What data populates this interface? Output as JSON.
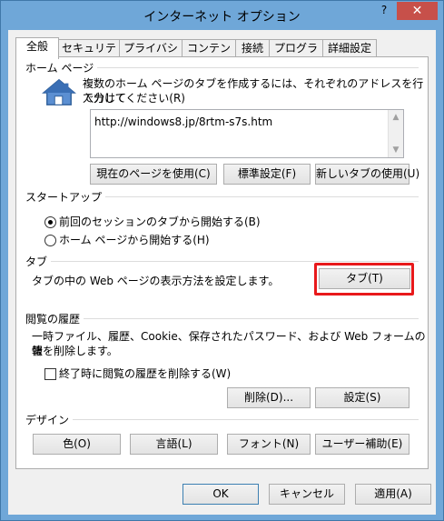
{
  "window": {
    "title": "インターネット オプション",
    "help": "?",
    "close": "✕"
  },
  "tabs": [
    "全般",
    "セキュリティ",
    "プライバシー",
    "コンテンツ",
    "接続",
    "プログラム",
    "詳細設定"
  ],
  "home": {
    "group": "ホーム ページ",
    "description_1": "複数のホーム ページのタブを作成するには、それぞれのアドレスを行で分けて",
    "description_2": "入力してください(R)",
    "url": "http://windows8.jp/8rtm-s7s.htm",
    "btn_current": "現在のページを使用(C)",
    "btn_default": "標準設定(F)",
    "btn_newtab": "新しいタブの使用(U)"
  },
  "startup": {
    "group": "スタートアップ",
    "opt_session": "前回のセッションのタブから開始する(B)",
    "opt_home": "ホーム ページから開始する(H)"
  },
  "tabs_group": {
    "group": "タブ",
    "description": "タブの中の Web ページの表示方法を設定します。",
    "btn_tabs": "タブ(T)"
  },
  "history": {
    "group": "閲覧の履歴",
    "description_1": "一時ファイル、履歴、Cookie、保存されたパスワード、および Web フォームの情",
    "description_2": "報を削除します。",
    "checkbox_label": "終了時に閲覧の履歴を削除する(W)",
    "btn_delete": "削除(D)...",
    "btn_settings": "設定(S)"
  },
  "design": {
    "group": "デザイン",
    "btn_colors": "色(O)",
    "btn_languages": "言語(L)",
    "btn_fonts": "フォント(N)",
    "btn_accessibility": "ユーザー補助(E)"
  },
  "footer": {
    "ok": "OK",
    "cancel": "キャンセル",
    "apply": "適用(A)"
  },
  "colors": {
    "titlebar": "#6fa7d8",
    "close": "#c7504a",
    "highlight": "#e8191b"
  }
}
